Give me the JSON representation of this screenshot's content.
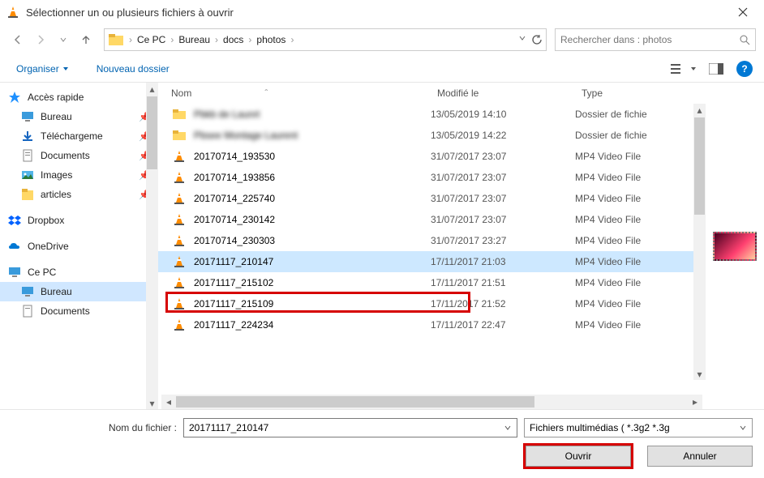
{
  "titlebar": {
    "title": "Sélectionner un ou plusieurs fichiers à ouvrir"
  },
  "nav": {
    "crumbs": [
      "Ce PC",
      "Bureau",
      "docs",
      "photos"
    ]
  },
  "search": {
    "placeholder": "Rechercher dans : photos"
  },
  "toolbar": {
    "organize": "Organiser",
    "newfolder": "Nouveau dossier"
  },
  "columns": {
    "name": "Nom",
    "modified": "Modifié le",
    "type": "Type"
  },
  "sidebar": {
    "quick": {
      "label": "Accès rapide",
      "items": [
        {
          "label": "Bureau"
        },
        {
          "label": "Téléchargeme"
        },
        {
          "label": "Documents"
        },
        {
          "label": "Images"
        },
        {
          "label": "articles"
        }
      ]
    },
    "dropbox": "Dropbox",
    "onedrive": "OneDrive",
    "thispc": {
      "label": "Ce PC",
      "items": [
        {
          "label": "Bureau",
          "selected": true
        },
        {
          "label": "Documents"
        }
      ]
    }
  },
  "files": [
    {
      "folder": true,
      "name": "Pbkb de Launrt",
      "modified": "13/05/2019 14:10",
      "type": "Dossier de fichie"
    },
    {
      "folder": true,
      "name": "Pbsee Montage Laurent",
      "modified": "13/05/2019 14:22",
      "type": "Dossier de fichie"
    },
    {
      "name": "20170714_193530",
      "modified": "31/07/2017 23:07",
      "type": "MP4 Video File"
    },
    {
      "name": "20170714_193856",
      "modified": "31/07/2017 23:07",
      "type": "MP4 Video File"
    },
    {
      "name": "20170714_225740",
      "modified": "31/07/2017 23:07",
      "type": "MP4 Video File"
    },
    {
      "name": "20170714_230142",
      "modified": "31/07/2017 23:07",
      "type": "MP4 Video File"
    },
    {
      "name": "20170714_230303",
      "modified": "31/07/2017 23:27",
      "type": "MP4 Video File"
    },
    {
      "name": "20171117_210147",
      "modified": "17/11/2017 21:03",
      "type": "MP4 Video File",
      "selected": true
    },
    {
      "name": "20171117_215102",
      "modified": "17/11/2017 21:51",
      "type": "MP4 Video File"
    },
    {
      "name": "20171117_215109",
      "modified": "17/11/2017 21:52",
      "type": "MP4 Video File"
    },
    {
      "name": "20171117_224234",
      "modified": "17/11/2017 22:47",
      "type": "MP4 Video File"
    }
  ],
  "footer": {
    "filename_label": "Nom du fichier :",
    "filename_value": "20171117_210147",
    "filter": "Fichiers multimédias ( *.3g2 *.3g",
    "open": "Ouvrir",
    "cancel": "Annuler"
  }
}
